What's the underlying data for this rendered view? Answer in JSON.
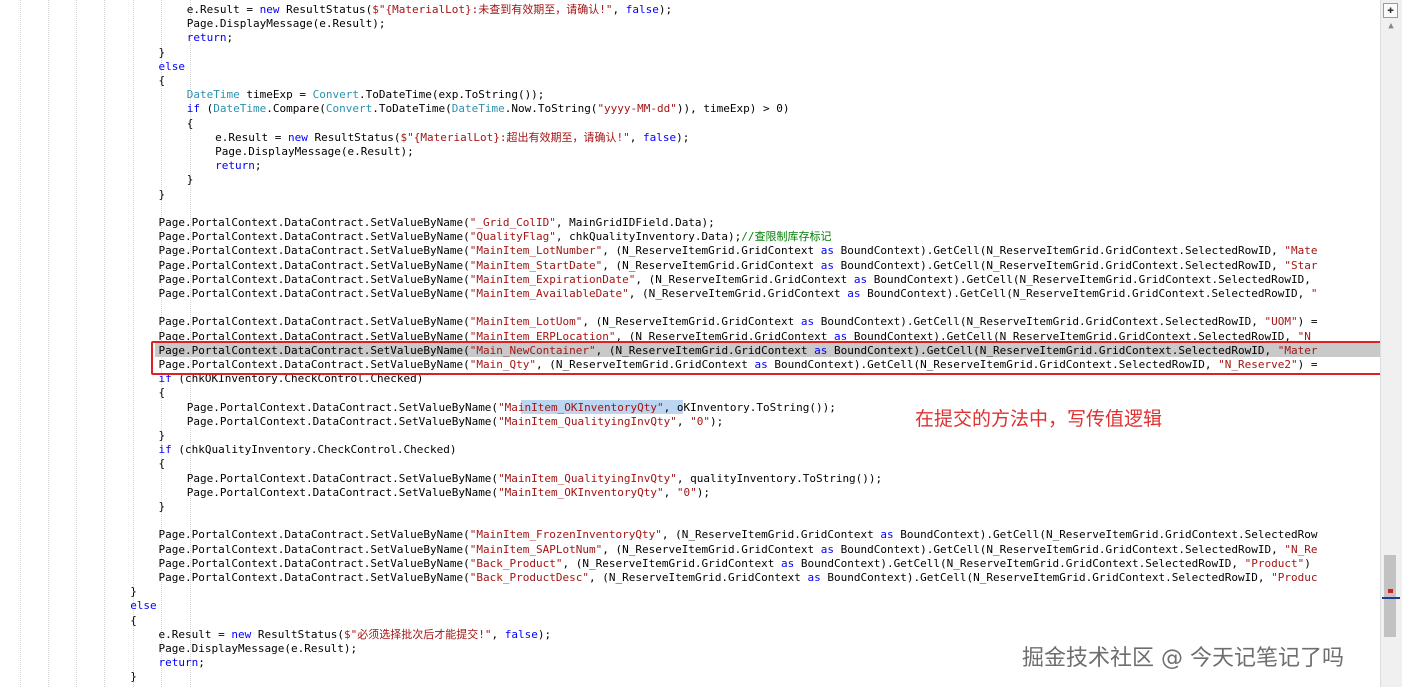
{
  "editor": {
    "lines": [
      {
        "indent": 6,
        "segs": [
          [
            "p",
            "e.Result = "
          ],
          [
            "k",
            "new"
          ],
          [
            "p",
            " ResultStatus("
          ],
          [
            "s",
            "$\"{MaterialLot}:未查到有效期至，请确认!\""
          ],
          [
            "p",
            ", "
          ],
          [
            "k",
            "false"
          ],
          [
            "p",
            ");"
          ]
        ]
      },
      {
        "indent": 6,
        "segs": [
          [
            "p",
            "Page.DisplayMessage(e.Result);"
          ]
        ]
      },
      {
        "indent": 6,
        "segs": [
          [
            "k",
            "return"
          ],
          [
            "p",
            ";"
          ]
        ]
      },
      {
        "indent": 5,
        "segs": [
          [
            "p",
            "}"
          ]
        ]
      },
      {
        "indent": 5,
        "segs": [
          [
            "k",
            "else"
          ]
        ]
      },
      {
        "indent": 5,
        "segs": [
          [
            "p",
            "{"
          ]
        ]
      },
      {
        "indent": 6,
        "segs": [
          [
            "t",
            "DateTime"
          ],
          [
            "p",
            " timeExp = "
          ],
          [
            "t",
            "Convert"
          ],
          [
            "p",
            ".ToDateTime(exp.ToString());"
          ]
        ]
      },
      {
        "indent": 6,
        "segs": [
          [
            "k",
            "if"
          ],
          [
            "p",
            " ("
          ],
          [
            "t",
            "DateTime"
          ],
          [
            "p",
            ".Compare("
          ],
          [
            "t",
            "Convert"
          ],
          [
            "p",
            ".ToDateTime("
          ],
          [
            "t",
            "DateTime"
          ],
          [
            "p",
            ".Now.ToString("
          ],
          [
            "s",
            "\"yyyy-MM-dd\""
          ],
          [
            "p",
            ")), timeExp) > 0)"
          ]
        ]
      },
      {
        "indent": 6,
        "segs": [
          [
            "p",
            "{"
          ]
        ]
      },
      {
        "indent": 7,
        "segs": [
          [
            "p",
            "e.Result = "
          ],
          [
            "k",
            "new"
          ],
          [
            "p",
            " ResultStatus("
          ],
          [
            "s",
            "$\"{MaterialLot}:超出有效期至，请确认!\""
          ],
          [
            "p",
            ", "
          ],
          [
            "k",
            "false"
          ],
          [
            "p",
            ");"
          ]
        ]
      },
      {
        "indent": 7,
        "segs": [
          [
            "p",
            "Page.DisplayMessage(e.Result);"
          ]
        ]
      },
      {
        "indent": 7,
        "segs": [
          [
            "k",
            "return"
          ],
          [
            "p",
            ";"
          ]
        ]
      },
      {
        "indent": 6,
        "segs": [
          [
            "p",
            "}"
          ]
        ]
      },
      {
        "indent": 5,
        "segs": [
          [
            "p",
            "}"
          ]
        ]
      },
      {
        "indent": 0,
        "segs": []
      },
      {
        "indent": 5,
        "segs": [
          [
            "p",
            "Page.PortalContext.DataContract.SetValueByName("
          ],
          [
            "s",
            "\"_Grid_ColID\""
          ],
          [
            "p",
            ", MainGridIDField.Data);"
          ]
        ]
      },
      {
        "indent": 5,
        "segs": [
          [
            "p",
            "Page.PortalContext.DataContract.SetValueByName("
          ],
          [
            "s",
            "\"QualityFlag\""
          ],
          [
            "p",
            ", chkQualityInventory.Data);"
          ],
          [
            "c",
            "//查限制库存标记"
          ]
        ]
      },
      {
        "indent": 5,
        "segs": [
          [
            "p",
            "Page.PortalContext.DataContract.SetValueByName("
          ],
          [
            "s",
            "\"MainItem_LotNumber\""
          ],
          [
            "p",
            ", (N_ReserveItemGrid.GridContext "
          ],
          [
            "k",
            "as"
          ],
          [
            "p",
            " BoundContext).GetCell(N_ReserveItemGrid.GridContext.SelectedRowID, "
          ],
          [
            "s",
            "\"Mate"
          ]
        ]
      },
      {
        "indent": 5,
        "segs": [
          [
            "p",
            "Page.PortalContext.DataContract.SetValueByName("
          ],
          [
            "s",
            "\"MainItem_StartDate\""
          ],
          [
            "p",
            ", (N_ReserveItemGrid.GridContext "
          ],
          [
            "k",
            "as"
          ],
          [
            "p",
            " BoundContext).GetCell(N_ReserveItemGrid.GridContext.SelectedRowID, "
          ],
          [
            "s",
            "\"Star"
          ]
        ]
      },
      {
        "indent": 5,
        "segs": [
          [
            "p",
            "Page.PortalContext.DataContract.SetValueByName("
          ],
          [
            "s",
            "\"MainItem_ExpirationDate\""
          ],
          [
            "p",
            ", (N_ReserveItemGrid.GridContext "
          ],
          [
            "k",
            "as"
          ],
          [
            "p",
            " BoundContext).GetCell(N_ReserveItemGrid.GridContext.SelectedRowID,"
          ]
        ]
      },
      {
        "indent": 5,
        "segs": [
          [
            "p",
            "Page.PortalContext.DataContract.SetValueByName("
          ],
          [
            "s",
            "\"MainItem_AvailableDate\""
          ],
          [
            "p",
            ", (N_ReserveItemGrid.GridContext "
          ],
          [
            "k",
            "as"
          ],
          [
            "p",
            " BoundContext).GetCell(N_ReserveItemGrid.GridContext.SelectedRowID, "
          ],
          [
            "s",
            "\""
          ]
        ]
      },
      {
        "indent": 0,
        "segs": []
      },
      {
        "indent": 5,
        "segs": [
          [
            "p",
            "Page.PortalContext.DataContract.SetValueByName("
          ],
          [
            "s",
            "\"MainItem_LotUom\""
          ],
          [
            "p",
            ", (N_ReserveItemGrid.GridContext "
          ],
          [
            "k",
            "as"
          ],
          [
            "p",
            " BoundContext).GetCell(N_ReserveItemGrid.GridContext.SelectedRowID, "
          ],
          [
            "s",
            "\"UOM\""
          ],
          [
            "p",
            ") ="
          ]
        ]
      },
      {
        "indent": 5,
        "segs": [
          [
            "p",
            "Page.PortalContext.DataContract.SetValueByName("
          ],
          [
            "s",
            "\"MainItem_ERPLocation\""
          ],
          [
            "p",
            ", (N_ReserveItemGrid.GridContext "
          ],
          [
            "k",
            "as"
          ],
          [
            "p",
            " BoundContext).GetCell(N_ReserveItemGrid.GridContext.SelectedRowID, "
          ],
          [
            "s",
            "\"N"
          ]
        ]
      },
      {
        "indent": 5,
        "segs": [
          [
            "p",
            "Page.PortalContext.DataContract.SetValueByName("
          ],
          [
            "s",
            "\"Main_NewContainer\""
          ],
          [
            "p",
            ", (N_ReserveItemGrid.GridContext "
          ],
          [
            "k",
            "as"
          ],
          [
            "p",
            " BoundContext).GetCell(N_ReserveItemGrid.GridContext.SelectedRowID, "
          ],
          [
            "s",
            "\"Mater"
          ]
        ]
      },
      {
        "indent": 5,
        "segs": [
          [
            "p",
            "Page.PortalContext.DataContract.SetValueByName("
          ],
          [
            "s",
            "\"Main_Qty\""
          ],
          [
            "p",
            ", (N_ReserveItemGrid.GridContext "
          ],
          [
            "k",
            "as"
          ],
          [
            "p",
            " BoundContext).GetCell(N_ReserveItemGrid.GridContext.SelectedRowID, "
          ],
          [
            "s",
            "\"N_Reserve2\""
          ],
          [
            "p",
            ") ="
          ]
        ]
      },
      {
        "indent": 5,
        "segs": [
          [
            "k",
            "if"
          ],
          [
            "p",
            " (chkOKInventory.CheckControl.Checked)"
          ]
        ]
      },
      {
        "indent": 5,
        "segs": [
          [
            "p",
            "{"
          ]
        ]
      },
      {
        "indent": 6,
        "segs": [
          [
            "p",
            "Page.PortalContext.DataContract.SetValueByName("
          ],
          [
            "s",
            "\"MainItem_OKInventoryQty\""
          ],
          [
            "p",
            ", oKInventory.ToString());"
          ]
        ]
      },
      {
        "indent": 6,
        "segs": [
          [
            "p",
            "Page.PortalContext.DataContract.SetValueByName("
          ],
          [
            "s",
            "\"MainItem_QualityingInvQty\""
          ],
          [
            "p",
            ", "
          ],
          [
            "s",
            "\"0\""
          ],
          [
            "p",
            ");"
          ]
        ]
      },
      {
        "indent": 5,
        "segs": [
          [
            "p",
            "}"
          ]
        ]
      },
      {
        "indent": 5,
        "segs": [
          [
            "k",
            "if"
          ],
          [
            "p",
            " (chkQualityInventory.CheckControl.Checked)"
          ]
        ]
      },
      {
        "indent": 5,
        "segs": [
          [
            "p",
            "{"
          ]
        ]
      },
      {
        "indent": 6,
        "segs": [
          [
            "p",
            "Page.PortalContext.DataContract.SetValueByName("
          ],
          [
            "s",
            "\"MainItem_QualityingInvQty\""
          ],
          [
            "p",
            ", qualityInventory.ToString());"
          ]
        ]
      },
      {
        "indent": 6,
        "segs": [
          [
            "p",
            "Page.PortalContext.DataContract.SetValueByName("
          ],
          [
            "s",
            "\"MainItem_OKInventoryQty\""
          ],
          [
            "p",
            ", "
          ],
          [
            "s",
            "\"0\""
          ],
          [
            "p",
            ");"
          ]
        ]
      },
      {
        "indent": 5,
        "segs": [
          [
            "p",
            "}"
          ]
        ]
      },
      {
        "indent": 0,
        "segs": []
      },
      {
        "indent": 5,
        "segs": [
          [
            "p",
            "Page.PortalContext.DataContract.SetValueByName("
          ],
          [
            "s",
            "\"MainItem_FrozenInventoryQty\""
          ],
          [
            "p",
            ", (N_ReserveItemGrid.GridContext "
          ],
          [
            "k",
            "as"
          ],
          [
            "p",
            " BoundContext).GetCell(N_ReserveItemGrid.GridContext.SelectedRow"
          ]
        ]
      },
      {
        "indent": 5,
        "segs": [
          [
            "p",
            "Page.PortalContext.DataContract.SetValueByName("
          ],
          [
            "s",
            "\"MainItem_SAPLotNum\""
          ],
          [
            "p",
            ", (N_ReserveItemGrid.GridContext "
          ],
          [
            "k",
            "as"
          ],
          [
            "p",
            " BoundContext).GetCell(N_ReserveItemGrid.GridContext.SelectedRowID, "
          ],
          [
            "s",
            "\"N_Re"
          ]
        ]
      },
      {
        "indent": 5,
        "segs": [
          [
            "p",
            "Page.PortalContext.DataContract.SetValueByName("
          ],
          [
            "s",
            "\"Back_Product\""
          ],
          [
            "p",
            ", (N_ReserveItemGrid.GridContext "
          ],
          [
            "k",
            "as"
          ],
          [
            "p",
            " BoundContext).GetCell(N_ReserveItemGrid.GridContext.SelectedRowID, "
          ],
          [
            "s",
            "\"Product\""
          ],
          [
            "p",
            ")"
          ]
        ]
      },
      {
        "indent": 5,
        "segs": [
          [
            "p",
            "Page.PortalContext.DataContract.SetValueByName("
          ],
          [
            "s",
            "\"Back_ProductDesc\""
          ],
          [
            "p",
            ", (N_ReserveItemGrid.GridContext "
          ],
          [
            "k",
            "as"
          ],
          [
            "p",
            " BoundContext).GetCell(N_ReserveItemGrid.GridContext.SelectedRowID, "
          ],
          [
            "s",
            "\"Produc"
          ]
        ]
      },
      {
        "indent": 4,
        "segs": [
          [
            "p",
            "}"
          ]
        ]
      },
      {
        "indent": 4,
        "segs": [
          [
            "k",
            "else"
          ]
        ]
      },
      {
        "indent": 4,
        "segs": [
          [
            "p",
            "{"
          ]
        ]
      },
      {
        "indent": 5,
        "segs": [
          [
            "p",
            "e.Result = "
          ],
          [
            "k",
            "new"
          ],
          [
            "p",
            " ResultStatus("
          ],
          [
            "s",
            "$\"必须选择批次后才能提交!\""
          ],
          [
            "p",
            ", "
          ],
          [
            "k",
            "false"
          ],
          [
            "p",
            ");"
          ]
        ]
      },
      {
        "indent": 5,
        "segs": [
          [
            "p",
            "Page.DisplayMessage(e.Result);"
          ]
        ]
      },
      {
        "indent": 5,
        "segs": [
          [
            "k",
            "return"
          ],
          [
            "p",
            ";"
          ]
        ]
      },
      {
        "indent": 4,
        "segs": [
          [
            "p",
            "}"
          ]
        ]
      }
    ]
  },
  "annotation": {
    "text": "在提交的方法中，写传值逻辑"
  },
  "watermark": {
    "text": "掘金技术社区 @ 今天记笔记了吗"
  },
  "scrollbar": {
    "split_icon": "✚",
    "up_arrow_icon": "▲"
  },
  "colors": {
    "keyword": "#0000ff",
    "type": "#2b91af",
    "string": "#a31515",
    "comment": "#008000",
    "annotation": "#e03030"
  }
}
